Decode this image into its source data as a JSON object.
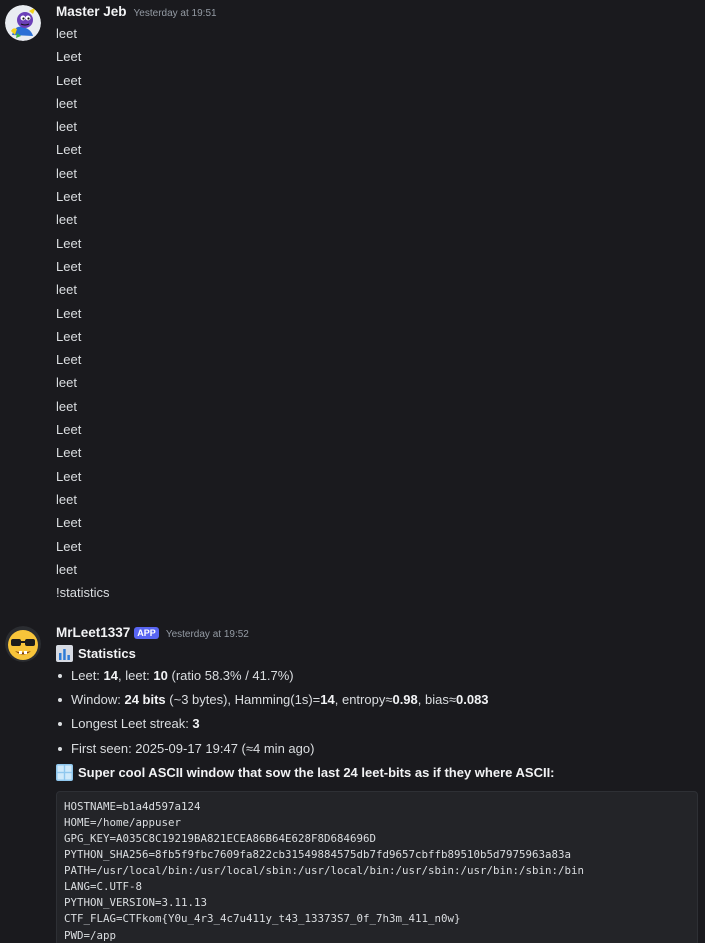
{
  "messages": [
    {
      "username": "Master Jeb",
      "timestamp": "Yesterday at 19:51",
      "lines": [
        "leet",
        "Leet",
        "Leet",
        "leet",
        "leet",
        "Leet",
        "leet",
        "Leet",
        "leet",
        "Leet",
        "Leet",
        "leet",
        "Leet",
        "Leet",
        "Leet",
        "leet",
        "leet",
        "Leet",
        "Leet",
        "Leet",
        "leet",
        "Leet",
        "Leet",
        "leet",
        "!statistics"
      ]
    },
    {
      "username": "MrLeet1337",
      "badge": "APP",
      "timestamp": "Yesterday at 19:52",
      "stats_title": "Statistics",
      "stats": [
        {
          "segments": [
            [
              "Leet: ",
              false
            ],
            [
              "14",
              true
            ],
            [
              ", leet: ",
              false
            ],
            [
              "10",
              true
            ],
            [
              " (ratio 58.3% / 41.7%)",
              false
            ]
          ]
        },
        {
          "segments": [
            [
              "Window: ",
              false
            ],
            [
              "24 bits",
              true
            ],
            [
              " (~3 bytes), Hamming(1s)=",
              false
            ],
            [
              "14",
              true
            ],
            [
              ", entropy≈",
              false
            ],
            [
              "0.98",
              true
            ],
            [
              ", bias≈",
              false
            ],
            [
              "0.083",
              true
            ]
          ]
        },
        {
          "segments": [
            [
              "Longest Leet streak: ",
              false
            ],
            [
              "3",
              true
            ]
          ]
        },
        {
          "segments": [
            [
              "First seen: 2025-09-17 19:47 (≈4 min ago)",
              false
            ]
          ]
        }
      ],
      "window_title": "Super cool ASCII window that sow the last 24 leet-bits as if they where ASCII:",
      "code_lines": [
        "HOSTNAME=b1a4d597a124",
        "HOME=/home/appuser",
        "GPG_KEY=A035C8C19219BA821ECEA86B64E628F8D684696D",
        "PYTHON_SHA256=8fb5f9fbc7609fa822cb31549884575db7fd9657cbffb89510b5d7975963a83a",
        "PATH=/usr/local/bin:/usr/local/sbin:/usr/local/bin:/usr/sbin:/usr/bin:/sbin:/bin",
        "LANG=C.UTF-8",
        "PYTHON_VERSION=3.11.13",
        "CTF_FLAG=CTFkom{Y0u_4r3_4c7u411y_t43_13373S7_0f_7h3m_411_n0w}",
        "PWD=/app"
      ]
    }
  ],
  "icons": {
    "msg1_avatar": "cartoon-avatar-icon",
    "msg2_avatar": "nerd-face-sunglasses-icon",
    "stats_emoji": "bar-chart-icon",
    "window_emoji": "window-icon"
  }
}
